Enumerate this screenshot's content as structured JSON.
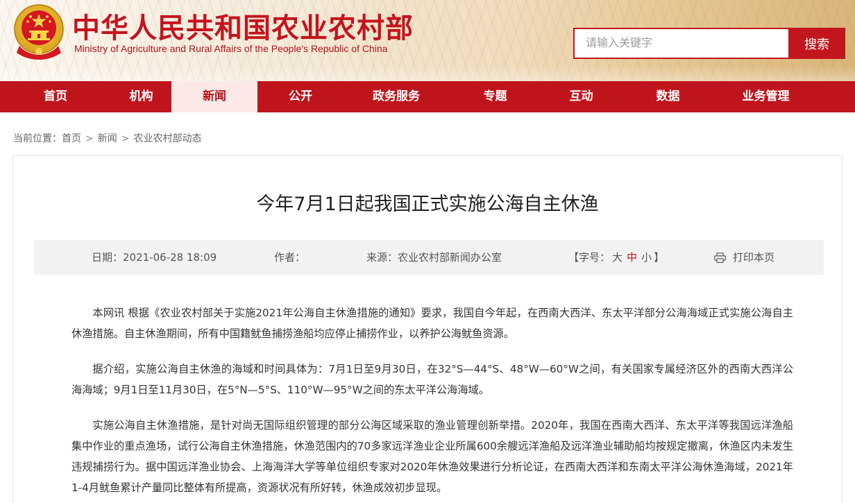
{
  "header": {
    "title": "中华人民共和国农业农村部",
    "subtitle": "Ministry of Agriculture and Rural Affairs of the People's Republic of China",
    "emblem_icon": "national-emblem-icon"
  },
  "search": {
    "placeholder": "请输入关键字",
    "button_label": "搜索"
  },
  "nav": {
    "items": [
      {
        "label": "首页"
      },
      {
        "label": "机构"
      },
      {
        "label": "新闻",
        "active": true
      },
      {
        "label": "公开"
      },
      {
        "label": "政务服务"
      },
      {
        "label": "专题"
      },
      {
        "label": "互动"
      },
      {
        "label": "数据"
      },
      {
        "label": "业务管理"
      }
    ]
  },
  "breadcrumb": {
    "prefix": "当前位置：",
    "items": [
      "首页",
      "新闻",
      "农业农村部动态"
    ],
    "separator": ">"
  },
  "article": {
    "title": "今年7月1日起我国正式实施公海自主休渔",
    "meta": {
      "date_label": "日期：",
      "date": "2021-06-28 18:09",
      "author_label": "作者：",
      "author": "",
      "source_label": "来源：",
      "source": "农业农村部新闻办公室",
      "fontsize_open": "【字号：",
      "fontsize_large": "大",
      "fontsize_medium": "中",
      "fontsize_small": "小",
      "fontsize_close": "】",
      "print_label": "打印本页",
      "print_icon": "printer-icon"
    },
    "paragraphs": [
      "本网讯 根据《农业农村部关于实施2021年公海自主休渔措施的通知》要求，我国自今年起，在西南大西洋、东太平洋部分公海海域正式实施公海自主休渔措施。自主休渔期间，所有中国籍鱿鱼捕捞渔船均应停止捕捞作业，以养护公海鱿鱼资源。",
      "据介绍，实施公海自主休渔的海域和时间具体为：7月1日至9月30日，在32°S—44°S、48°W—60°W之间，有关国家专属经济区外的西南大西洋公海海域；9月1日至11月30日，在5°N—5°S、110°W—95°W之间的东太平洋公海海域。",
      "实施公海自主休渔措施，是针对尚无国际组织管理的部分公海区域采取的渔业管理创新举措。2020年，我国在西南大西洋、东太平洋等我国远洋渔船集中作业的重点渔场，试行公海自主休渔措施，休渔范围内的70多家远洋渔业企业所属600余艘远洋渔船及远洋渔业辅助船均按规定撤离，休渔区内未发生违规捕捞行为。据中国远洋渔业协会、上海海洋大学等单位组织专家对2020年休渔效果进行分析论证，在西南大西洋和东南太平洋公海休渔海域，2021年1-4月鱿鱼累计产量同比整体有所提高，资源状况有所好转，休渔成效初步显现。"
    ]
  },
  "colors": {
    "brand_red": "#c0141c",
    "nav_active_bg": "#fce9e7",
    "meta_bg": "#f2f2f2"
  }
}
